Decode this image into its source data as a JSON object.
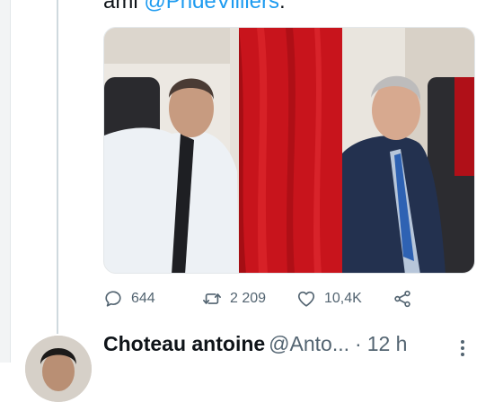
{
  "tweet": {
    "text_prefix": "ami",
    "mention": "@PhdeVilliers",
    "text_suffix": "."
  },
  "actions": {
    "reply_count": "644",
    "retweet_count": "2 209",
    "like_count": "10,4K"
  },
  "reply": {
    "author_name": "Choteau antoine",
    "handle": "@Anto...",
    "separator": "·",
    "time": "12 h"
  },
  "icons": {
    "reply": "reply-icon",
    "retweet": "retweet-icon",
    "like": "heart-icon",
    "share": "share-icon",
    "more": "more-icon"
  },
  "colors": {
    "link": "#1d9bf0",
    "text": "#0f1419",
    "muted": "#536471"
  }
}
